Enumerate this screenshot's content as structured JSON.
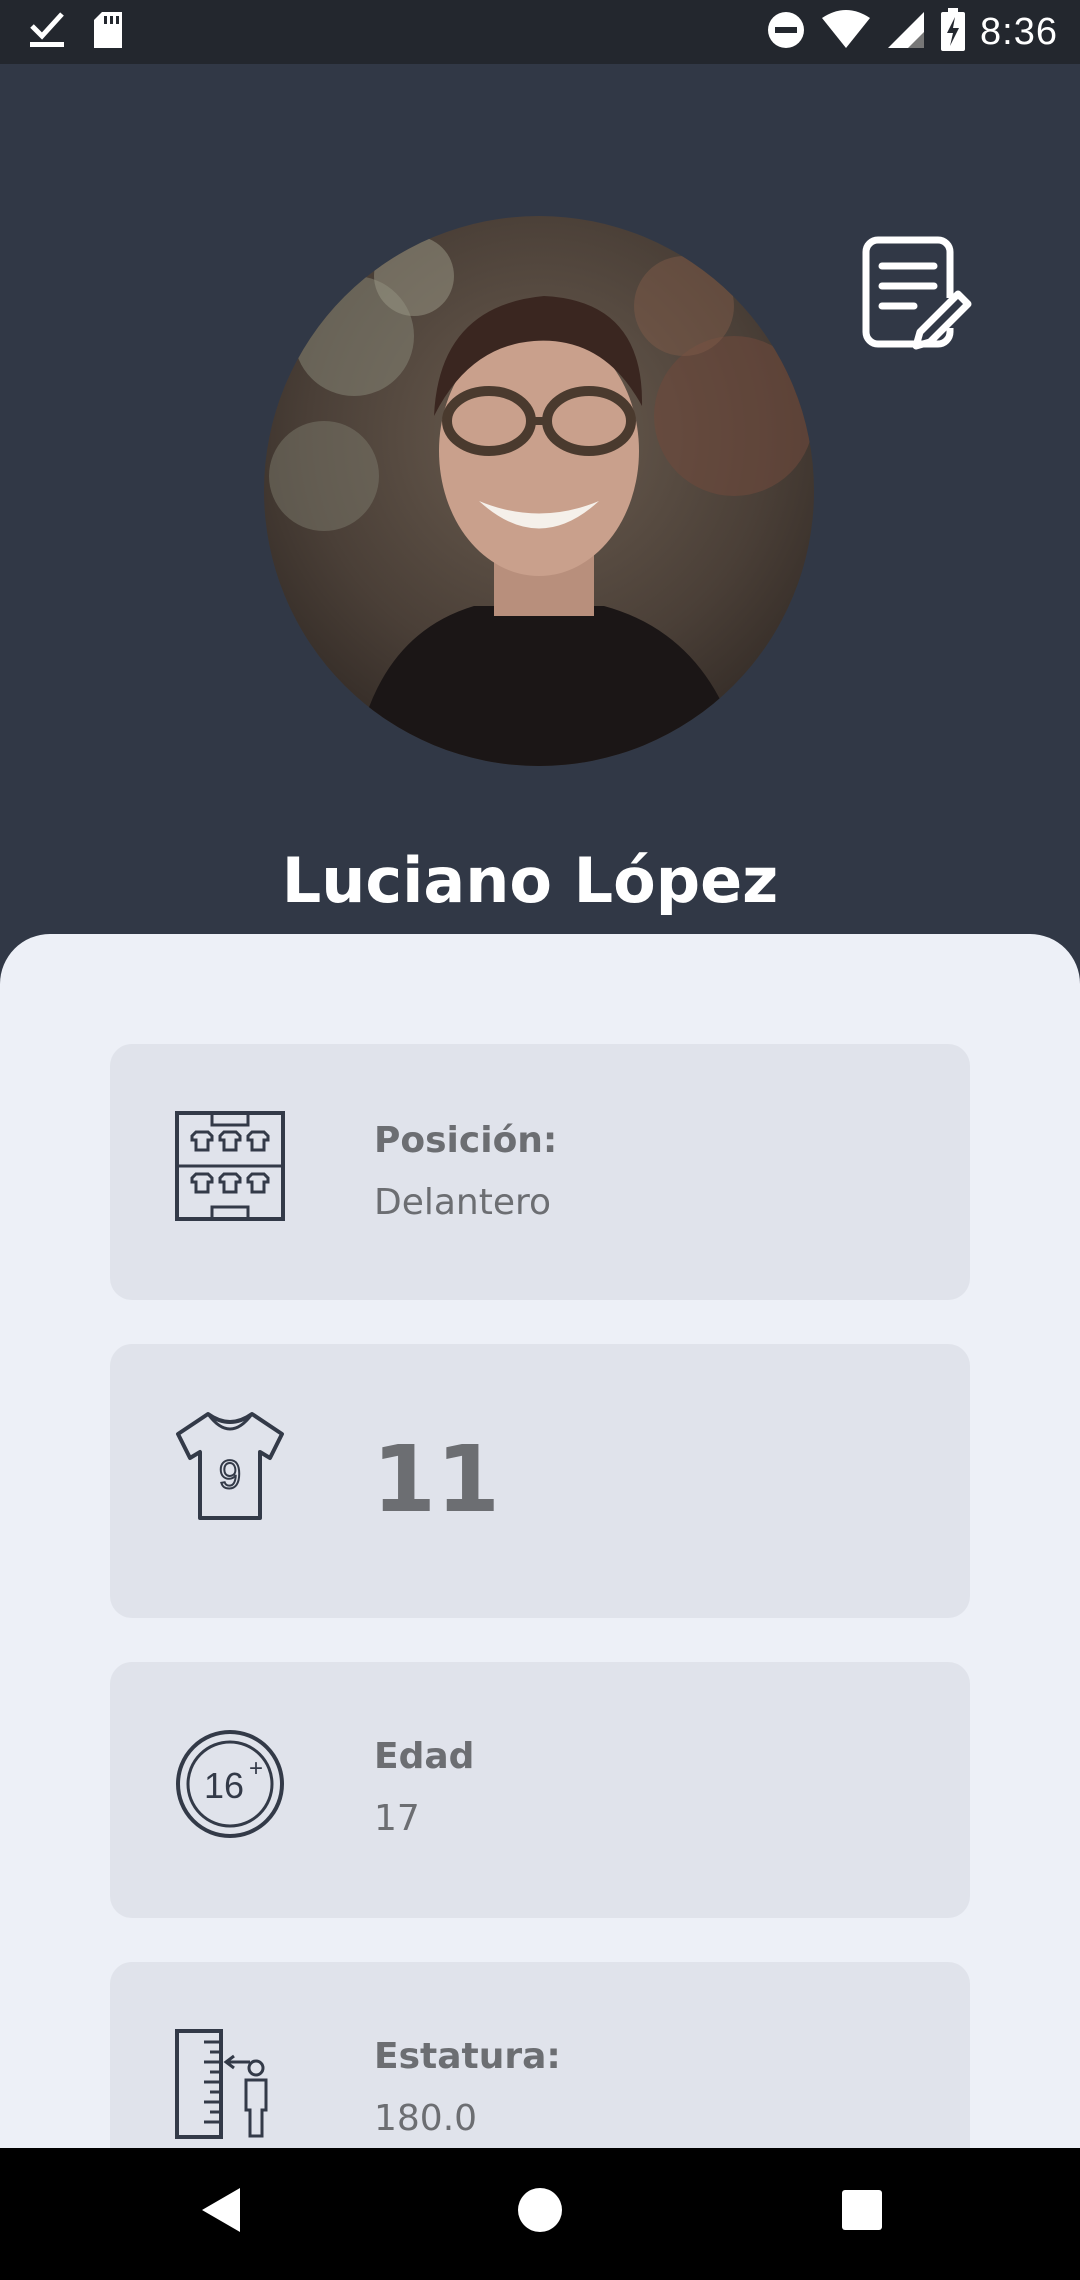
{
  "status_bar": {
    "time": "8:36",
    "left_icons": [
      "download-done-icon",
      "sd-card-icon"
    ],
    "right_icons": [
      "do-not-disturb-icon",
      "wifi-icon",
      "cell-signal-icon",
      "battery-charging-icon"
    ]
  },
  "profile": {
    "name": "Luciano López",
    "edit_icon": "edit-note-icon"
  },
  "cards": {
    "position": {
      "label": "Posición:",
      "value": "Delantero",
      "icon": "formation-icon"
    },
    "number": {
      "value": "11",
      "icon": "jersey-icon"
    },
    "age": {
      "label": "Edad",
      "value": "17",
      "icon": "age-16-plus-icon"
    },
    "height": {
      "label": "Estatura:",
      "value": "180.0",
      "icon": "height-ruler-icon"
    }
  },
  "colors": {
    "header_bg": "#313846",
    "sheet_bg": "#edf0f7",
    "card_bg": "#e0e3eb",
    "text_gray": "#6c6e72"
  },
  "nav": [
    "back-icon",
    "home-icon",
    "recents-icon"
  ]
}
